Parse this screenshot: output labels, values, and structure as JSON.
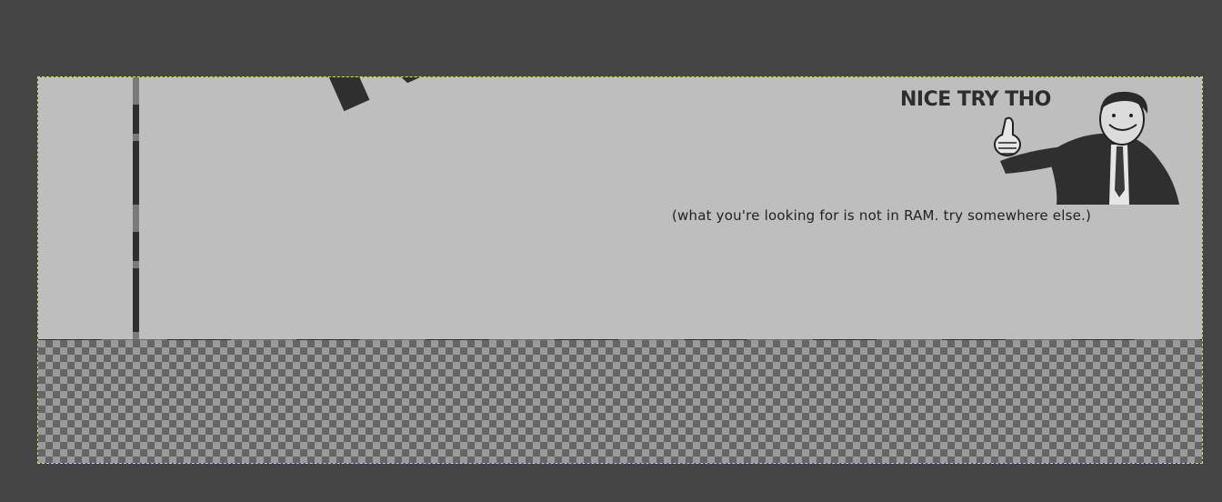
{
  "canvas": {
    "big_text": "NOT",
    "headline": "NICE TRY THO",
    "caption": "(what you're looking for is not in RAM. try somewhere else.)",
    "image_icon": "thumbs-up-man-icon"
  },
  "colors": {
    "workspace": "#454545",
    "layer_fill": "#bebebe",
    "ink": "#2f2f2f",
    "selection_outline": "#d8d86a"
  }
}
